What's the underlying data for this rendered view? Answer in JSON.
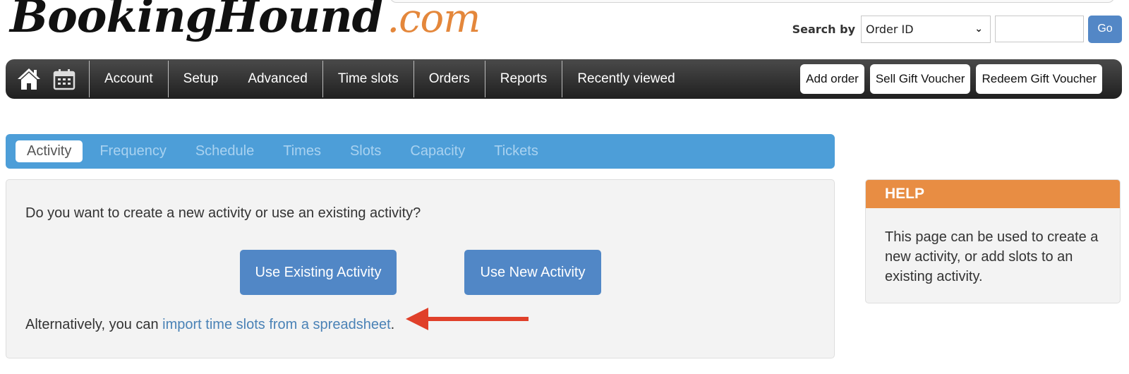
{
  "brand": {
    "logo_main": "BookingHound",
    "logo_tld": ".com",
    "accent_orange": "#e4873b"
  },
  "search": {
    "label": "Search by",
    "selected_option": "Order ID",
    "input_value": "",
    "input_placeholder": "",
    "go_label": "Go"
  },
  "nav": {
    "icons": [
      "home-icon",
      "calendar-icon"
    ],
    "items": [
      "Account",
      "Setup",
      "Advanced",
      "Time slots",
      "Orders",
      "Reports",
      "Recently viewed"
    ],
    "buttons": [
      "Add order",
      "Sell Gift Voucher",
      "Redeem Gift Voucher"
    ]
  },
  "wizard": {
    "tabs": [
      {
        "label": "Activity",
        "active": true
      },
      {
        "label": "Frequency",
        "active": false
      },
      {
        "label": "Schedule",
        "active": false
      },
      {
        "label": "Times",
        "active": false
      },
      {
        "label": "Slots",
        "active": false
      },
      {
        "label": "Capacity",
        "active": false
      },
      {
        "label": "Tickets",
        "active": false
      }
    ]
  },
  "main": {
    "question": "Do you want to create a new activity or use an existing activity?",
    "use_existing_label": "Use Existing Activity",
    "use_new_label": "Use New Activity",
    "alt_prefix": "Alternatively, you can ",
    "alt_link": "import time slots from a spreadsheet",
    "alt_suffix": ".",
    "annotation_arrow_color": "#e0402a"
  },
  "help": {
    "title": "HELP",
    "text": "This page can be used to create a new activity, or add slots to an existing activity."
  }
}
